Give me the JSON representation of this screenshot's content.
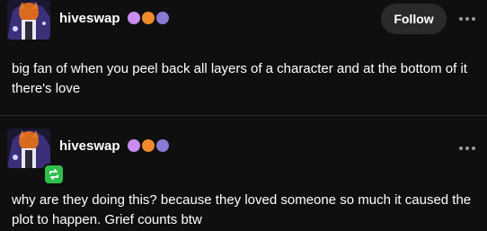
{
  "posts": [
    {
      "username": "hiveswap",
      "badges": [
        "#c98cf0",
        "#f08a2a",
        "#8a7ad6"
      ],
      "follow_label": "Follow",
      "text": "big fan of  when you peel back all layers of a character and at the bottom of it there's love"
    },
    {
      "username": "hiveswap",
      "badges": [
        "#c98cf0",
        "#f08a2a",
        "#8a7ad6"
      ],
      "reblog": true,
      "text": "why are they doing this? because they loved someone so much it caused the plot to happen. Grief counts btw"
    }
  ],
  "icons": {
    "more": "more-options-icon",
    "reblog": "reblog-icon"
  }
}
